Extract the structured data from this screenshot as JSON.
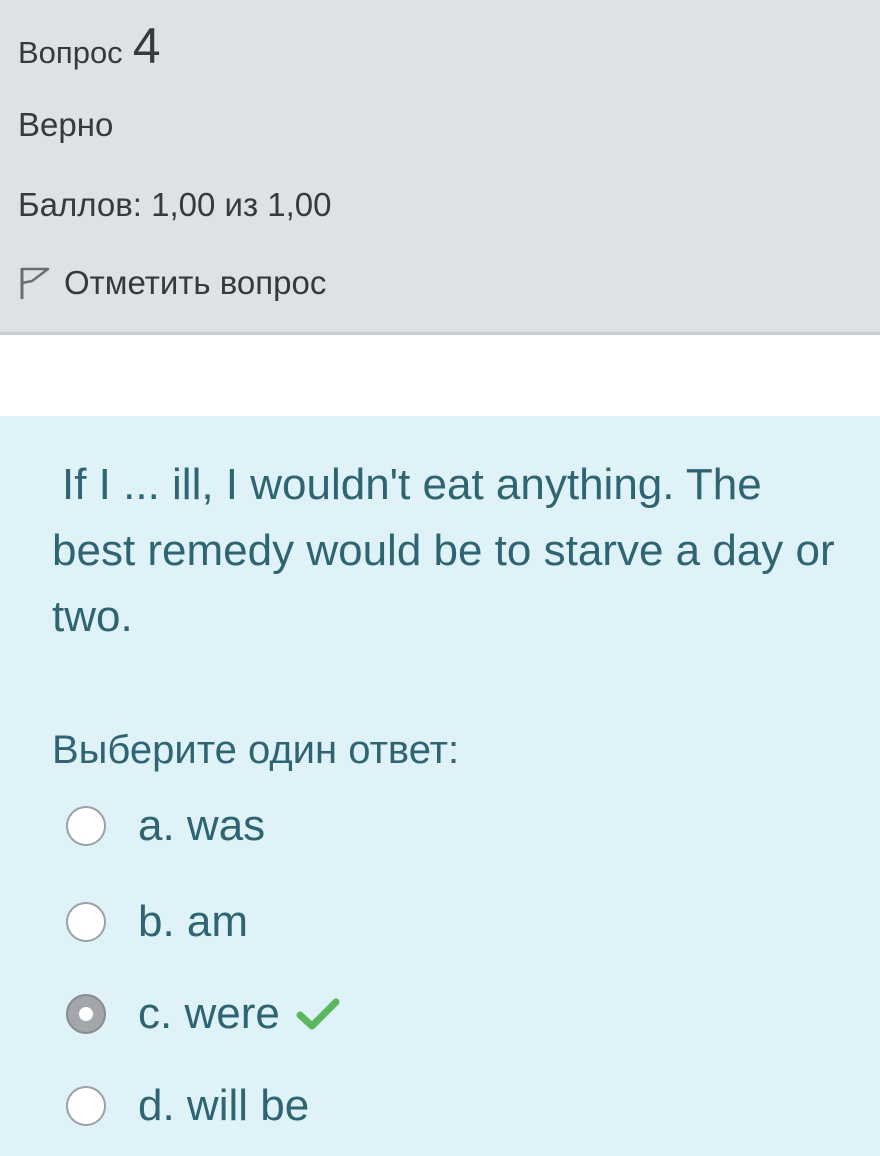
{
  "info": {
    "question_label": "Вопрос",
    "question_number": "4",
    "state": "Верно",
    "grade": "Баллов: 1,00 из 1,00",
    "flag_label": "Отметить вопрос",
    "flag_icon": "flag-outline-icon"
  },
  "question": {
    "text": "If I ...  ill, I wouldn't eat anything. The best remedy would be to starve a day or two.",
    "prompt": "Выберите один ответ:",
    "answers": [
      {
        "label": "a. was",
        "checked": false
      },
      {
        "label": "b. am",
        "checked": false
      },
      {
        "label": "c. were",
        "checked": true,
        "correct_icon": "checkmark-icon"
      },
      {
        "label": "d. will be",
        "checked": false
      }
    ]
  },
  "colors": {
    "info_bg": "#dee2e6",
    "formulation_bg": "#def2f8",
    "text_teal": "#2f6473",
    "check_green": "#5cb85c"
  }
}
